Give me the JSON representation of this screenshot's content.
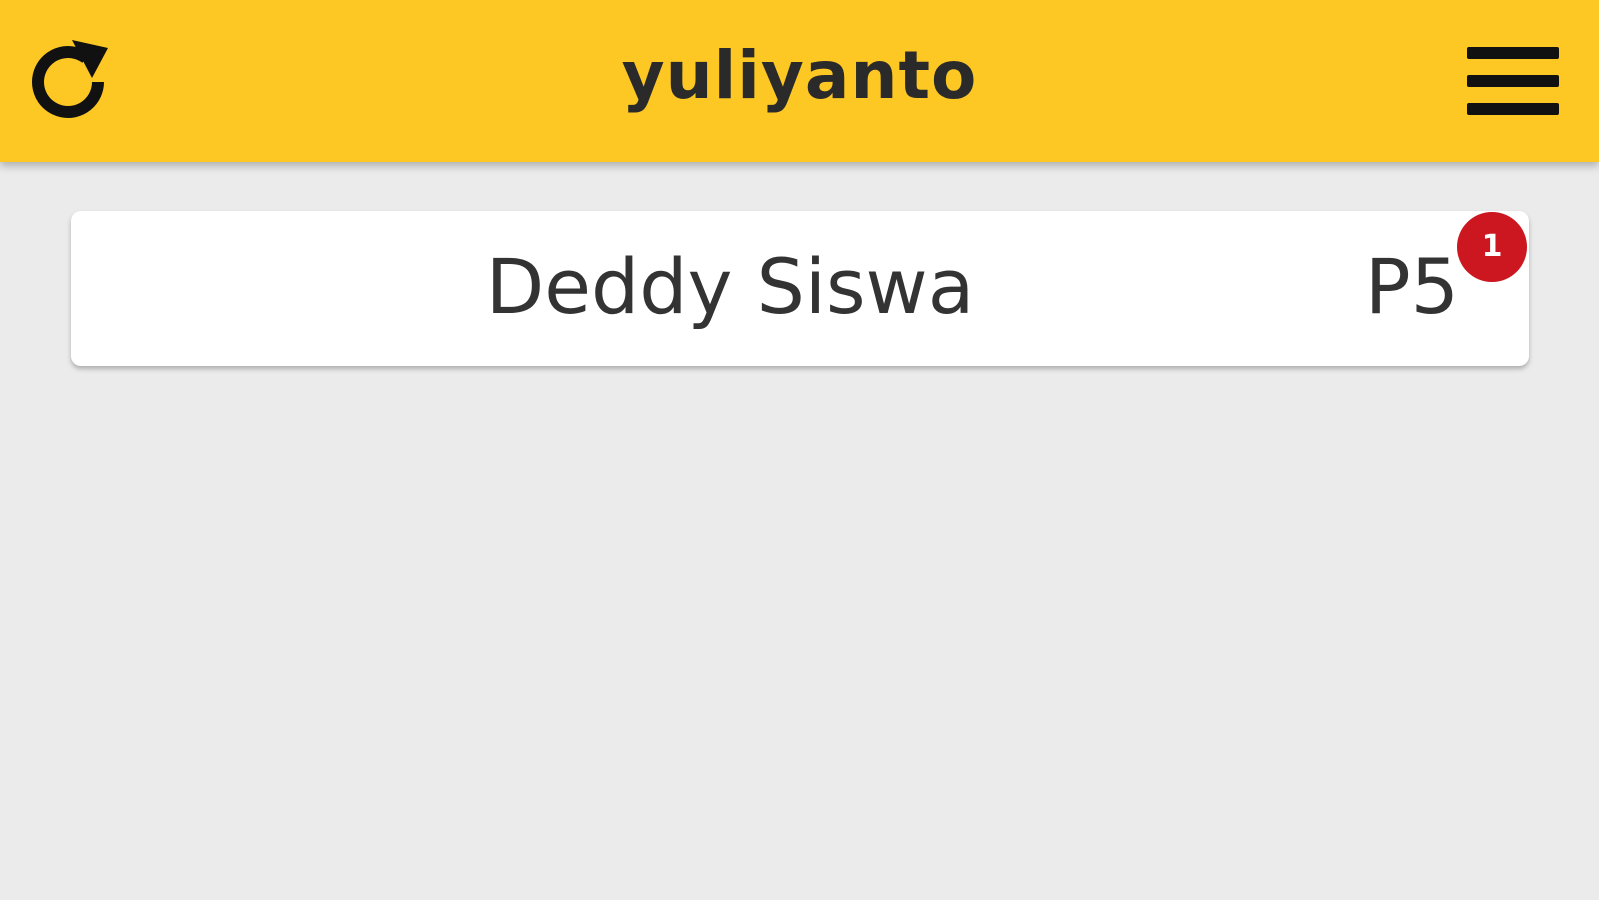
{
  "header": {
    "title": "yuliyanto",
    "refresh_icon": "refresh-icon",
    "menu_icon": "hamburger-menu-icon",
    "background_color": "#fdc823"
  },
  "list": {
    "items": [
      {
        "name": "Deddy Siswa",
        "code": "P5",
        "badge_count": "1",
        "badge_color": "#cc1620"
      }
    ]
  }
}
